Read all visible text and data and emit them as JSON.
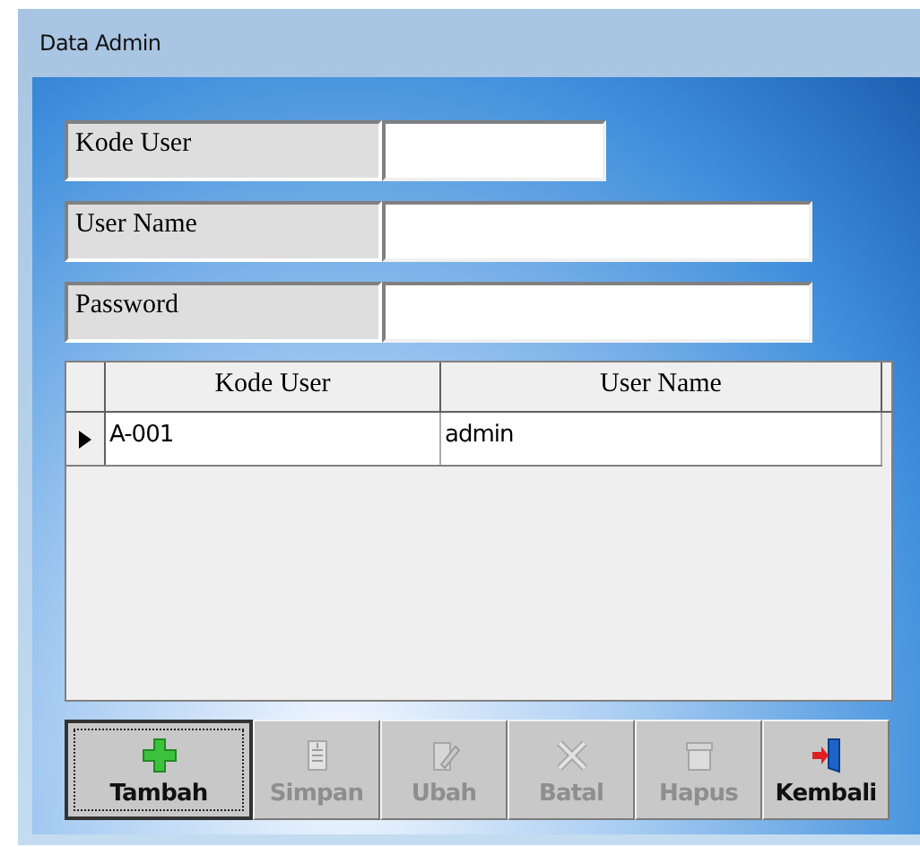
{
  "window": {
    "title": "Data Admin"
  },
  "fields": [
    {
      "label": "Kode User"
    },
    {
      "label": "User Name"
    },
    {
      "label": "Password"
    }
  ],
  "table": {
    "columns": [
      "Kode User",
      "User Name"
    ],
    "rows": [
      {
        "cells": [
          "A-001",
          "admin"
        ],
        "selected": true
      }
    ]
  },
  "buttons": [
    {
      "label": "Tambah",
      "kind": "add",
      "disabled": false,
      "focused": true
    },
    {
      "label": "Simpan",
      "kind": "save",
      "disabled": true,
      "focused": false
    },
    {
      "label": "Ubah",
      "kind": "edit",
      "disabled": true,
      "focused": false
    },
    {
      "label": "Batal",
      "kind": "cancel",
      "disabled": true,
      "focused": false
    },
    {
      "label": "Hapus",
      "kind": "delete",
      "disabled": true,
      "focused": false
    },
    {
      "label": "Kembali",
      "kind": "exit",
      "disabled": false,
      "focused": false
    }
  ]
}
